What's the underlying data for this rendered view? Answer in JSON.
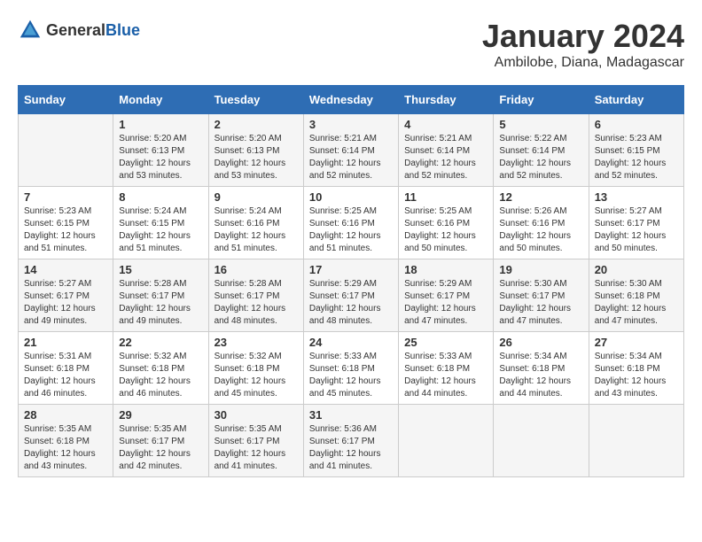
{
  "logo": {
    "text_general": "General",
    "text_blue": "Blue"
  },
  "header": {
    "month": "January 2024",
    "location": "Ambilobe, Diana, Madagascar"
  },
  "days_of_week": [
    "Sunday",
    "Monday",
    "Tuesday",
    "Wednesday",
    "Thursday",
    "Friday",
    "Saturday"
  ],
  "weeks": [
    [
      {
        "day": "",
        "sunrise": "",
        "sunset": "",
        "daylight": ""
      },
      {
        "day": "1",
        "sunrise": "Sunrise: 5:20 AM",
        "sunset": "Sunset: 6:13 PM",
        "daylight": "Daylight: 12 hours and 53 minutes."
      },
      {
        "day": "2",
        "sunrise": "Sunrise: 5:20 AM",
        "sunset": "Sunset: 6:13 PM",
        "daylight": "Daylight: 12 hours and 53 minutes."
      },
      {
        "day": "3",
        "sunrise": "Sunrise: 5:21 AM",
        "sunset": "Sunset: 6:14 PM",
        "daylight": "Daylight: 12 hours and 52 minutes."
      },
      {
        "day": "4",
        "sunrise": "Sunrise: 5:21 AM",
        "sunset": "Sunset: 6:14 PM",
        "daylight": "Daylight: 12 hours and 52 minutes."
      },
      {
        "day": "5",
        "sunrise": "Sunrise: 5:22 AM",
        "sunset": "Sunset: 6:14 PM",
        "daylight": "Daylight: 12 hours and 52 minutes."
      },
      {
        "day": "6",
        "sunrise": "Sunrise: 5:23 AM",
        "sunset": "Sunset: 6:15 PM",
        "daylight": "Daylight: 12 hours and 52 minutes."
      }
    ],
    [
      {
        "day": "7",
        "sunrise": "Sunrise: 5:23 AM",
        "sunset": "Sunset: 6:15 PM",
        "daylight": "Daylight: 12 hours and 51 minutes."
      },
      {
        "day": "8",
        "sunrise": "Sunrise: 5:24 AM",
        "sunset": "Sunset: 6:15 PM",
        "daylight": "Daylight: 12 hours and 51 minutes."
      },
      {
        "day": "9",
        "sunrise": "Sunrise: 5:24 AM",
        "sunset": "Sunset: 6:16 PM",
        "daylight": "Daylight: 12 hours and 51 minutes."
      },
      {
        "day": "10",
        "sunrise": "Sunrise: 5:25 AM",
        "sunset": "Sunset: 6:16 PM",
        "daylight": "Daylight: 12 hours and 51 minutes."
      },
      {
        "day": "11",
        "sunrise": "Sunrise: 5:25 AM",
        "sunset": "Sunset: 6:16 PM",
        "daylight": "Daylight: 12 hours and 50 minutes."
      },
      {
        "day": "12",
        "sunrise": "Sunrise: 5:26 AM",
        "sunset": "Sunset: 6:16 PM",
        "daylight": "Daylight: 12 hours and 50 minutes."
      },
      {
        "day": "13",
        "sunrise": "Sunrise: 5:27 AM",
        "sunset": "Sunset: 6:17 PM",
        "daylight": "Daylight: 12 hours and 50 minutes."
      }
    ],
    [
      {
        "day": "14",
        "sunrise": "Sunrise: 5:27 AM",
        "sunset": "Sunset: 6:17 PM",
        "daylight": "Daylight: 12 hours and 49 minutes."
      },
      {
        "day": "15",
        "sunrise": "Sunrise: 5:28 AM",
        "sunset": "Sunset: 6:17 PM",
        "daylight": "Daylight: 12 hours and 49 minutes."
      },
      {
        "day": "16",
        "sunrise": "Sunrise: 5:28 AM",
        "sunset": "Sunset: 6:17 PM",
        "daylight": "Daylight: 12 hours and 48 minutes."
      },
      {
        "day": "17",
        "sunrise": "Sunrise: 5:29 AM",
        "sunset": "Sunset: 6:17 PM",
        "daylight": "Daylight: 12 hours and 48 minutes."
      },
      {
        "day": "18",
        "sunrise": "Sunrise: 5:29 AM",
        "sunset": "Sunset: 6:17 PM",
        "daylight": "Daylight: 12 hours and 47 minutes."
      },
      {
        "day": "19",
        "sunrise": "Sunrise: 5:30 AM",
        "sunset": "Sunset: 6:17 PM",
        "daylight": "Daylight: 12 hours and 47 minutes."
      },
      {
        "day": "20",
        "sunrise": "Sunrise: 5:30 AM",
        "sunset": "Sunset: 6:18 PM",
        "daylight": "Daylight: 12 hours and 47 minutes."
      }
    ],
    [
      {
        "day": "21",
        "sunrise": "Sunrise: 5:31 AM",
        "sunset": "Sunset: 6:18 PM",
        "daylight": "Daylight: 12 hours and 46 minutes."
      },
      {
        "day": "22",
        "sunrise": "Sunrise: 5:32 AM",
        "sunset": "Sunset: 6:18 PM",
        "daylight": "Daylight: 12 hours and 46 minutes."
      },
      {
        "day": "23",
        "sunrise": "Sunrise: 5:32 AM",
        "sunset": "Sunset: 6:18 PM",
        "daylight": "Daylight: 12 hours and 45 minutes."
      },
      {
        "day": "24",
        "sunrise": "Sunrise: 5:33 AM",
        "sunset": "Sunset: 6:18 PM",
        "daylight": "Daylight: 12 hours and 45 minutes."
      },
      {
        "day": "25",
        "sunrise": "Sunrise: 5:33 AM",
        "sunset": "Sunset: 6:18 PM",
        "daylight": "Daylight: 12 hours and 44 minutes."
      },
      {
        "day": "26",
        "sunrise": "Sunrise: 5:34 AM",
        "sunset": "Sunset: 6:18 PM",
        "daylight": "Daylight: 12 hours and 44 minutes."
      },
      {
        "day": "27",
        "sunrise": "Sunrise: 5:34 AM",
        "sunset": "Sunset: 6:18 PM",
        "daylight": "Daylight: 12 hours and 43 minutes."
      }
    ],
    [
      {
        "day": "28",
        "sunrise": "Sunrise: 5:35 AM",
        "sunset": "Sunset: 6:18 PM",
        "daylight": "Daylight: 12 hours and 43 minutes."
      },
      {
        "day": "29",
        "sunrise": "Sunrise: 5:35 AM",
        "sunset": "Sunset: 6:17 PM",
        "daylight": "Daylight: 12 hours and 42 minutes."
      },
      {
        "day": "30",
        "sunrise": "Sunrise: 5:35 AM",
        "sunset": "Sunset: 6:17 PM",
        "daylight": "Daylight: 12 hours and 41 minutes."
      },
      {
        "day": "31",
        "sunrise": "Sunrise: 5:36 AM",
        "sunset": "Sunset: 6:17 PM",
        "daylight": "Daylight: 12 hours and 41 minutes."
      },
      {
        "day": "",
        "sunrise": "",
        "sunset": "",
        "daylight": ""
      },
      {
        "day": "",
        "sunrise": "",
        "sunset": "",
        "daylight": ""
      },
      {
        "day": "",
        "sunrise": "",
        "sunset": "",
        "daylight": ""
      }
    ]
  ]
}
